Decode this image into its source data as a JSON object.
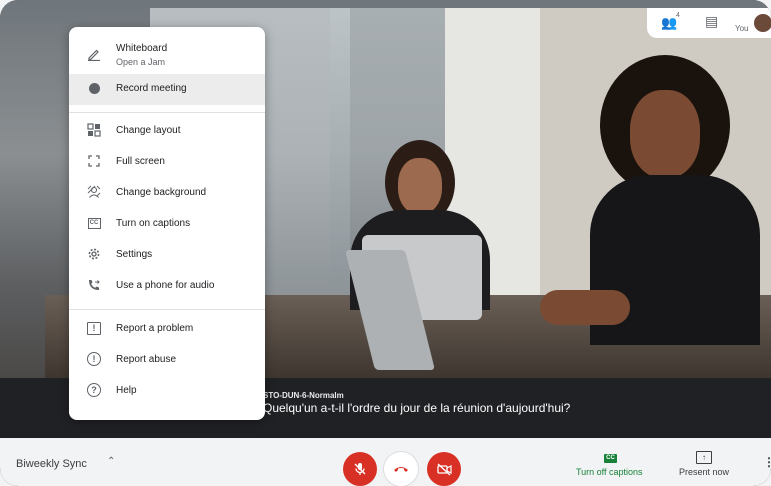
{
  "menu": {
    "items": [
      {
        "label": "Whiteboard",
        "sublabel": "Open a Jam",
        "icon": "pen-icon"
      },
      {
        "label": "Record meeting",
        "icon": "record-dot-icon"
      },
      {
        "label": "Change layout",
        "icon": "layout-icon"
      },
      {
        "label": "Full screen",
        "icon": "fullscreen-icon"
      },
      {
        "label": "Change background",
        "icon": "background-icon"
      },
      {
        "label": "Turn on captions",
        "icon": "captions-icon"
      },
      {
        "label": "Settings",
        "icon": "gear-icon"
      },
      {
        "label": "Use a phone for audio",
        "icon": "phone-icon"
      },
      {
        "label": "Report a problem",
        "icon": "feedback-icon"
      },
      {
        "label": "Report abuse",
        "icon": "alert-icon"
      },
      {
        "label": "Help",
        "icon": "help-icon"
      }
    ]
  },
  "caption": {
    "speaker": "STO-DUN-6-Normalm",
    "text": "Quelqu'un a-t-il l'ordre du jour de la réunion d'aujourd'hui?"
  },
  "top": {
    "participants_count": "4",
    "self_label": "You"
  },
  "bottom": {
    "meeting_name": "Biweekly Sync",
    "captions_label": "Turn off captions",
    "captions_icon_text": "CC",
    "present_label": "Present now"
  }
}
